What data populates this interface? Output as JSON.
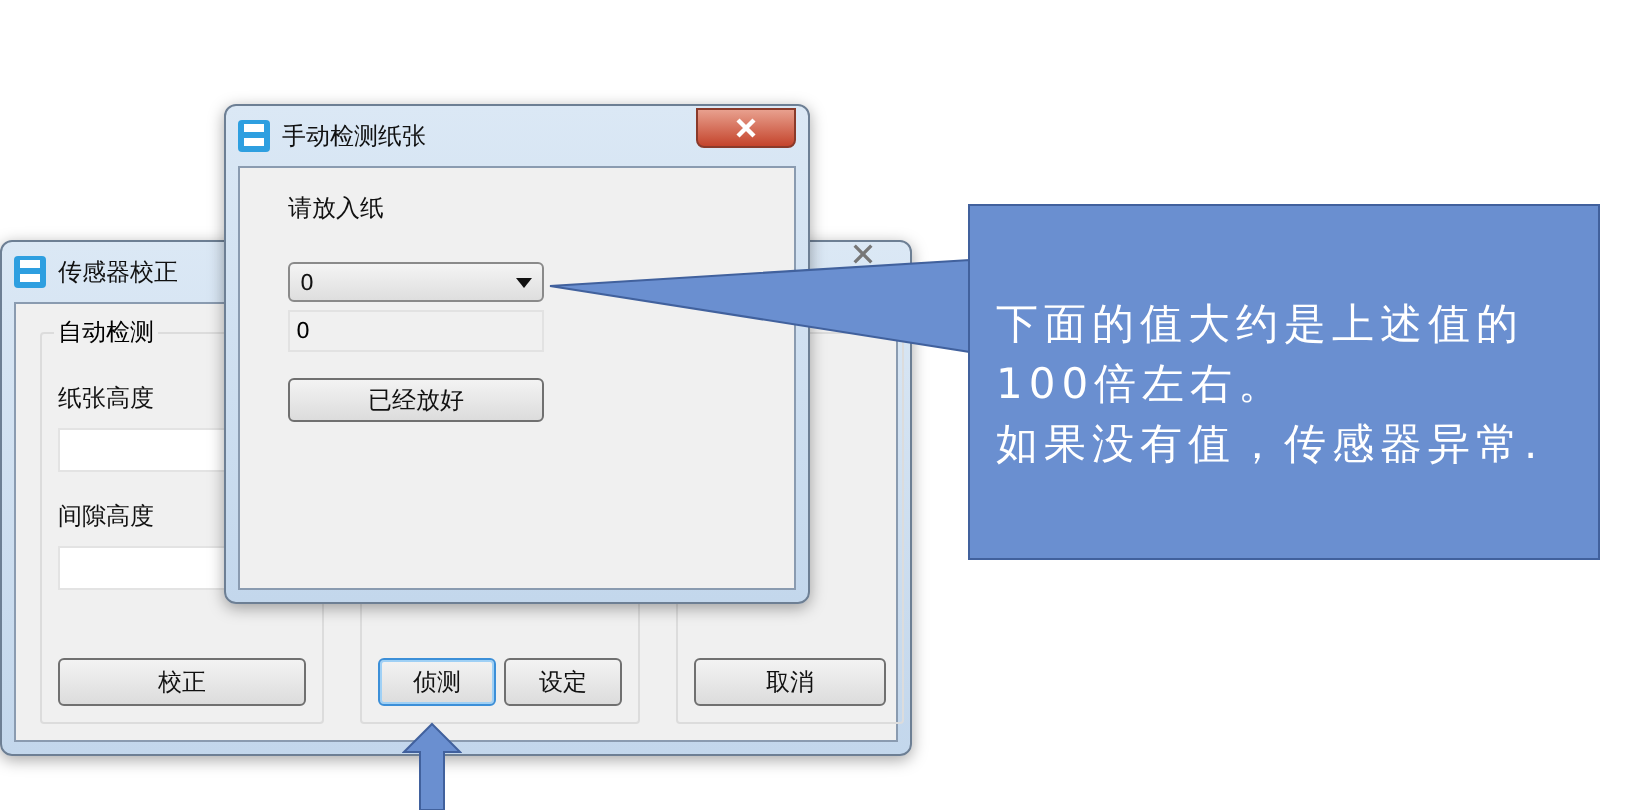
{
  "back_window": {
    "title": "传感器校正",
    "auto_group": {
      "title": "自动检测",
      "fields": [
        {
          "label": "纸张高度"
        },
        {
          "label": "间隙高度"
        }
      ]
    },
    "button_groups": [
      [
        {
          "label": "校正",
          "focused": false
        }
      ],
      [
        {
          "label": "侦测",
          "focused": true
        },
        {
          "label": "设定",
          "focused": false
        }
      ],
      [
        {
          "label": "取消",
          "focused": false
        }
      ]
    ]
  },
  "dialog": {
    "title": "手动检测纸张",
    "prompt": "请放入纸",
    "select": {
      "value": "0"
    },
    "readout": {
      "value": "0"
    },
    "button": "已经放好"
  },
  "callout": {
    "paragraphs": [
      "下面的值大约是上述值的100倍左右。",
      "如果没有值，传感器异常."
    ]
  }
}
